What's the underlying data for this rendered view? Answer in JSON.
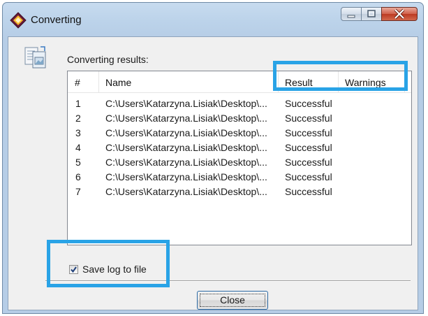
{
  "window": {
    "title": "Converting"
  },
  "dialog": {
    "section_label": "Converting results:",
    "columns": [
      {
        "key": "num",
        "label": "#"
      },
      {
        "key": "name",
        "label": "Name"
      },
      {
        "key": "result",
        "label": "Result"
      },
      {
        "key": "warnings",
        "label": "Warnings"
      }
    ],
    "rows": [
      {
        "num": "1",
        "name": "C:\\Users\\Katarzyna.Lisiak\\Desktop\\...",
        "result": "Successful",
        "warnings": ""
      },
      {
        "num": "2",
        "name": "C:\\Users\\Katarzyna.Lisiak\\Desktop\\...",
        "result": "Successful",
        "warnings": ""
      },
      {
        "num": "3",
        "name": "C:\\Users\\Katarzyna.Lisiak\\Desktop\\...",
        "result": "Successful",
        "warnings": ""
      },
      {
        "num": "4",
        "name": "C:\\Users\\Katarzyna.Lisiak\\Desktop\\...",
        "result": "Successful",
        "warnings": ""
      },
      {
        "num": "5",
        "name": "C:\\Users\\Katarzyna.Lisiak\\Desktop\\...",
        "result": "Successful",
        "warnings": ""
      },
      {
        "num": "6",
        "name": "C:\\Users\\Katarzyna.Lisiak\\Desktop\\...",
        "result": "Successful",
        "warnings": ""
      },
      {
        "num": "7",
        "name": "C:\\Users\\Katarzyna.Lisiak\\Desktop\\...",
        "result": "Successful",
        "warnings": ""
      }
    ],
    "save_log": {
      "label": "Save log to file",
      "checked": true
    },
    "close_label": "Close"
  },
  "colors": {
    "highlight": "#29a3e6",
    "titlebar": "#bcd3ea",
    "close_button": "#c8462f"
  },
  "icons": {
    "app": "app-diamond-icon",
    "document": "document-image-icon",
    "check": "checkmark-icon"
  }
}
